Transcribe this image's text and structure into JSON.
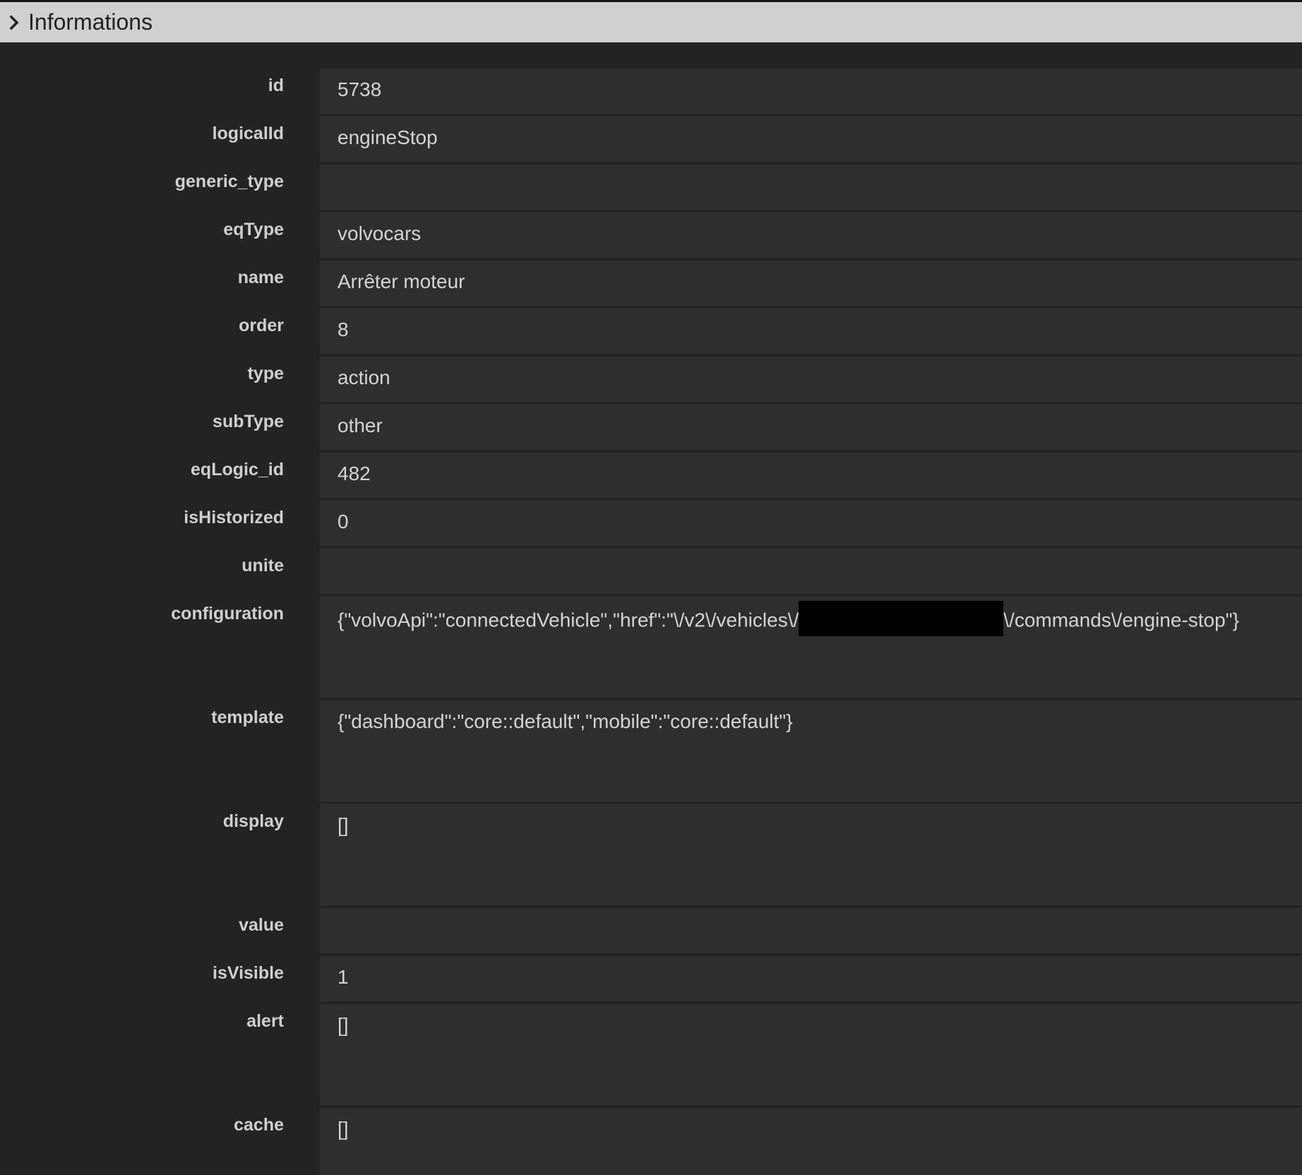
{
  "header": {
    "title": "Informations"
  },
  "rows": [
    {
      "label": "id",
      "value": "5738"
    },
    {
      "label": "logicalId",
      "value": "engineStop"
    },
    {
      "label": "generic_type",
      "value": ""
    },
    {
      "label": "eqType",
      "value": "volvocars"
    },
    {
      "label": "name",
      "value": "Arrêter moteur"
    },
    {
      "label": "order",
      "value": "8"
    },
    {
      "label": "type",
      "value": "action"
    },
    {
      "label": "subType",
      "value": "other"
    },
    {
      "label": "eqLogic_id",
      "value": "482"
    },
    {
      "label": "isHistorized",
      "value": "0"
    },
    {
      "label": "unite",
      "value": ""
    },
    {
      "label": "configuration",
      "value_part1": "{\"volvoApi\":\"connectedVehicle\",\"href\":\"\\/v2\\/vehicles\\/",
      "value_part2": "\\/commands\\/engine-stop\"}"
    },
    {
      "label": "template",
      "value": "{\"dashboard\":\"core::default\",\"mobile\":\"core::default\"}"
    },
    {
      "label": "display",
      "value": "[]"
    },
    {
      "label": "value",
      "value": ""
    },
    {
      "label": "isVisible",
      "value": "1"
    },
    {
      "label": "alert",
      "value": "[]"
    },
    {
      "label": "cache",
      "value": "[]"
    }
  ]
}
